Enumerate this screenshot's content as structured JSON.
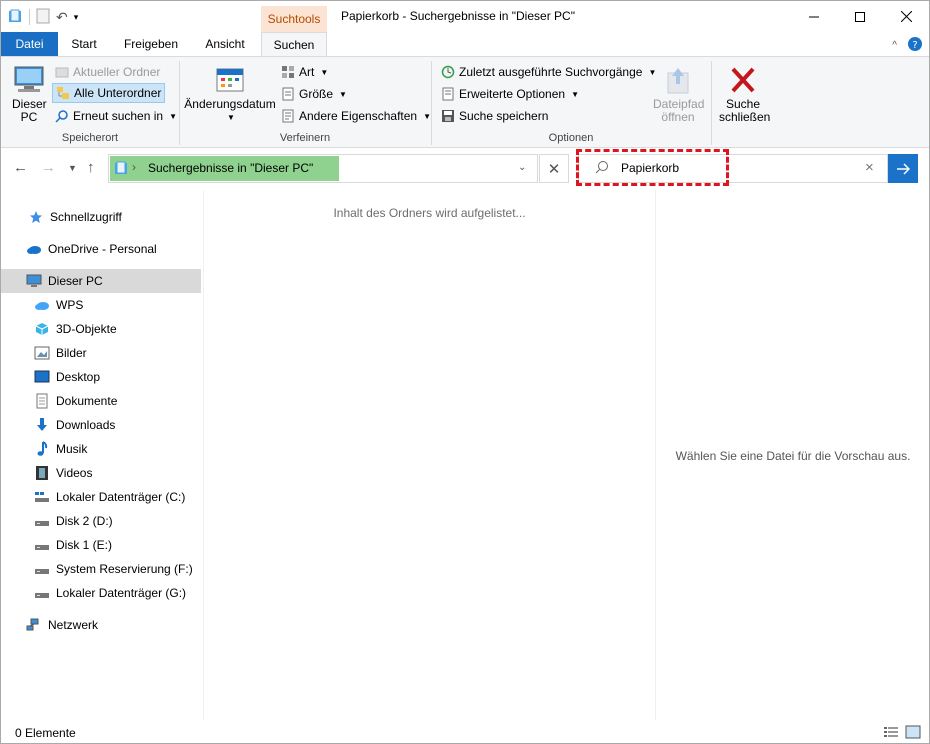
{
  "window": {
    "title": "Papierkorb - Suchergebnisse in \"Dieser PC\"",
    "context_tab_header": "Suchtools"
  },
  "tabs": [
    {
      "label": "Datei"
    },
    {
      "label": "Start"
    },
    {
      "label": "Freigeben"
    },
    {
      "label": "Ansicht"
    },
    {
      "label": "Suchen"
    }
  ],
  "ribbon": {
    "location": {
      "this_pc_label": "Dieser PC",
      "current_folder": "Aktueller Ordner",
      "all_subfolders": "Alle Unterordner",
      "search_again": "Erneut suchen in",
      "group_label": "Speicherort"
    },
    "refine": {
      "date_modified": "Änderungsdatum",
      "kind": "Art",
      "size": "Größe",
      "other_properties": "Andere Eigenschaften",
      "group_label": "Verfeinern"
    },
    "options": {
      "recent_searches": "Zuletzt ausgeführte Suchvorgänge",
      "advanced_options": "Erweiterte Optionen",
      "save_search": "Suche speichern",
      "open_file_location": "Dateipfad öffnen",
      "close_search": "Suche schließen",
      "group_label": "Optionen"
    }
  },
  "address_bar": {
    "path": "Suchergebnisse in \"Dieser PC\""
  },
  "search": {
    "value": "Papierkorb"
  },
  "nav_pane": {
    "items": [
      {
        "label": "Schnellzugriff",
        "icon": "star-icon"
      },
      {
        "label": "OneDrive - Personal",
        "icon": "cloud-icon"
      },
      {
        "label": "Dieser PC",
        "icon": "computer-icon"
      },
      {
        "label": "WPS",
        "icon": "cloud-icon"
      },
      {
        "label": "3D-Objekte",
        "icon": "cube-icon"
      },
      {
        "label": "Bilder",
        "icon": "pictures-icon"
      },
      {
        "label": "Desktop",
        "icon": "desktop-icon"
      },
      {
        "label": "Dokumente",
        "icon": "document-icon"
      },
      {
        "label": "Downloads",
        "icon": "download-icon"
      },
      {
        "label": "Musik",
        "icon": "music-icon"
      },
      {
        "label": "Videos",
        "icon": "video-icon"
      },
      {
        "label": "Lokaler Datenträger (C:)",
        "icon": "drive-icon"
      },
      {
        "label": "Disk 2 (D:)",
        "icon": "drive-icon"
      },
      {
        "label": "Disk 1 (E:)",
        "icon": "drive-icon"
      },
      {
        "label": "System Reservierung (F:)",
        "icon": "drive-icon"
      },
      {
        "label": "Lokaler Datenträger (G:)",
        "icon": "drive-icon"
      },
      {
        "label": "Netzwerk",
        "icon": "network-icon"
      }
    ]
  },
  "main": {
    "empty_message": "Inhalt des Ordners wird aufgelistet..."
  },
  "preview": {
    "message": "Wählen Sie eine Datei für die Vorschau aus."
  },
  "status": {
    "item_count": "0 Elemente"
  },
  "colors": {
    "accent": "#1a6fc4",
    "context_tab": "#fce4d4",
    "address_highlight": "#8fd18e",
    "search_highlight_border": "#e0141e"
  }
}
